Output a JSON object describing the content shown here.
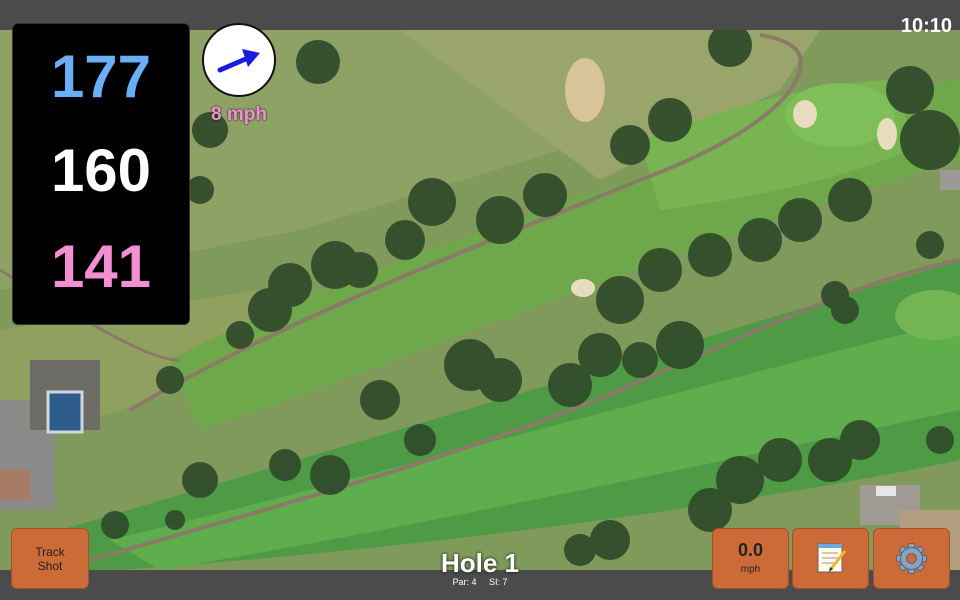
{
  "status": {
    "time": "10:10"
  },
  "distances": {
    "back": "177",
    "center": "160",
    "front": "141"
  },
  "wind": {
    "speed_label": "8 mph",
    "button_value": "0.0",
    "button_unit": "mph"
  },
  "hole": {
    "title": "Hole 1",
    "par": "Par: 4",
    "stroke_index": "SI: 7"
  },
  "buttons": {
    "track_shot_line1": "Track",
    "track_shot_line2": "Shot"
  },
  "icons": {
    "wind_arrow": "arrow-icon",
    "notes": "notepad-icon",
    "settings": "gear-icon"
  },
  "colors": {
    "back": "#6aaef5",
    "center": "#ffffff",
    "front": "#f48fd3",
    "button": "#cc6b37"
  }
}
